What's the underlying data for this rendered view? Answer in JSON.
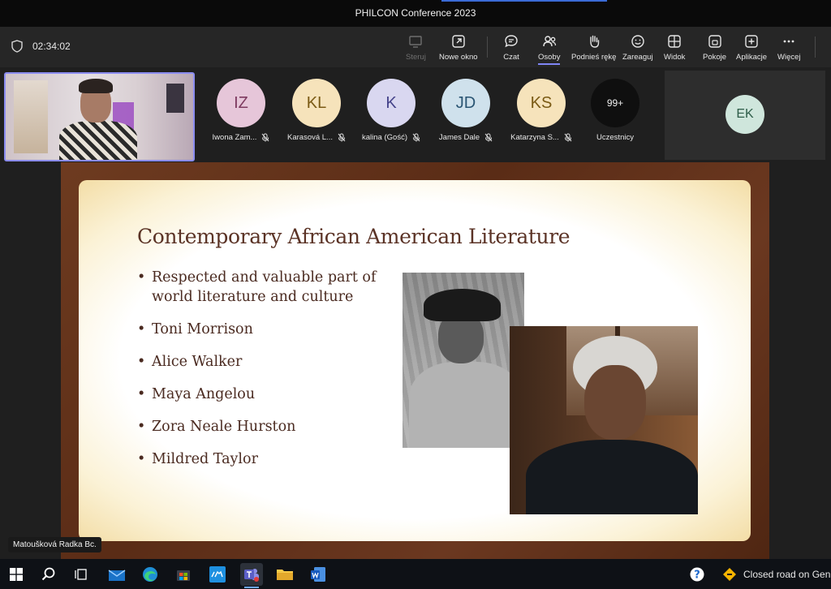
{
  "window": {
    "title": "PHILCON Conference 2023"
  },
  "meeting": {
    "timer": "02:34:02",
    "toolbar": [
      {
        "label": "Steruj",
        "icon": "share-control-icon",
        "disabled": true
      },
      {
        "label": "Nowe okno",
        "icon": "new-window-icon"
      },
      {
        "label": "Czat",
        "icon": "chat-icon"
      },
      {
        "label": "Osoby",
        "icon": "people-icon",
        "active": true
      },
      {
        "label": "Podnieś rękę",
        "icon": "raise-hand-icon"
      },
      {
        "label": "Zareaguj",
        "icon": "react-icon"
      },
      {
        "label": "Widok",
        "icon": "view-icon"
      },
      {
        "label": "Pokoje",
        "icon": "rooms-icon"
      },
      {
        "label": "Aplikacje",
        "icon": "apps-icon"
      },
      {
        "label": "Więcej",
        "icon": "more-icon"
      }
    ]
  },
  "participants": [
    {
      "initials": "IZ",
      "name": "Iwona Zam...",
      "bg": "#e6c6d9",
      "fg": "#7d3a5f"
    },
    {
      "initials": "KL",
      "name": "Karasová L...",
      "bg": "#f6e3bb",
      "fg": "#7a5a14"
    },
    {
      "initials": "K",
      "name": "kalina (Gość)",
      "bg": "#d9d7f0",
      "fg": "#45438a"
    },
    {
      "initials": "JD",
      "name": "James Dale",
      "bg": "#cfe1ec",
      "fg": "#2a5573"
    },
    {
      "initials": "KS",
      "name": "Katarzyna S...",
      "bg": "#f6e3bb",
      "fg": "#7a5a14"
    }
  ],
  "overflow": {
    "count": "99+",
    "label": "Uczestnicy"
  },
  "pinned": {
    "initials": "EK",
    "bg": "#cfe6dc",
    "fg": "#2e5d49"
  },
  "slide": {
    "title": "Contemporary African American Literature",
    "bullets": [
      "Respected and valuable part of world literature and culture",
      "Toni Morrison",
      "Alice Walker",
      "Maya Angelou",
      "Zora Neale Hurston",
      "Mildred Taylor"
    ]
  },
  "speaker": "Matoušková Radka Bc.",
  "taskbar": {
    "weather": "Closed road on Gen..."
  }
}
